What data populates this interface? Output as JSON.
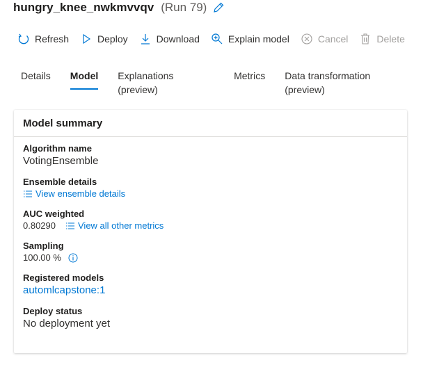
{
  "header": {
    "run_name": "hungry_knee_nwkmvvqv",
    "run_id": "(Run 79)"
  },
  "toolbar": {
    "refresh": "Refresh",
    "deploy": "Deploy",
    "download": "Download",
    "explain": "Explain model",
    "cancel": "Cancel",
    "delete": "Delete"
  },
  "tabs": [
    {
      "label": "Details"
    },
    {
      "label": "Model"
    },
    {
      "label": "Explanations (preview)"
    },
    {
      "label": "Metrics"
    },
    {
      "label": "Data transformation (preview)"
    }
  ],
  "summary": {
    "title": "Model summary",
    "algorithm": {
      "label": "Algorithm name",
      "value": "VotingEnsemble"
    },
    "ensemble": {
      "label": "Ensemble details",
      "link": "View ensemble details"
    },
    "auc": {
      "label": "AUC weighted",
      "value": "0.80290",
      "link": "View all other metrics"
    },
    "sampling": {
      "label": "Sampling",
      "value": "100.00 %"
    },
    "registered": {
      "label": "Registered models",
      "value": "automlcapstone:1"
    },
    "deploy_status": {
      "label": "Deploy status",
      "value": "No deployment yet"
    }
  },
  "colors": {
    "accent": "#0078d4",
    "text": "#323130",
    "disabled": "#a19f9d"
  }
}
